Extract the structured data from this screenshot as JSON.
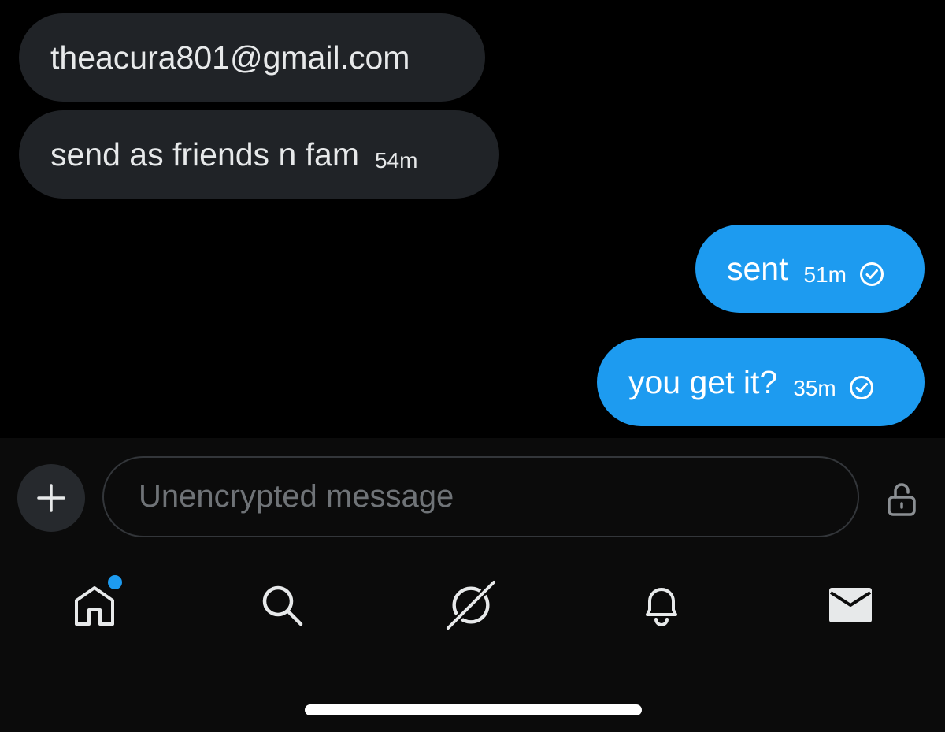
{
  "conversation": {
    "messages": [
      {
        "direction": "incoming",
        "text": "theacura801@gmail.com",
        "time": ""
      },
      {
        "direction": "incoming",
        "text": "send as friends n fam",
        "time": "54m"
      },
      {
        "direction": "outgoing",
        "text": "sent",
        "time": "51m",
        "status_icon": "check-circle-icon"
      },
      {
        "direction": "outgoing",
        "text": "you get it?",
        "time": "35m",
        "status_icon": "check-circle-icon"
      }
    ]
  },
  "composer": {
    "value": "",
    "placeholder": "Unencrypted message",
    "add_icon": "plus-icon",
    "lock_icon": "unlocked-padlock-icon"
  },
  "tab_bar": {
    "items": [
      {
        "name": "home",
        "icon": "home-icon",
        "has_notification_dot": true
      },
      {
        "name": "search",
        "icon": "search-icon"
      },
      {
        "name": "grok",
        "icon": "grok-icon"
      },
      {
        "name": "notifications",
        "icon": "bell-icon"
      },
      {
        "name": "messages",
        "icon": "envelope-icon",
        "active": true
      }
    ]
  },
  "colors": {
    "background": "#000000",
    "incoming_bubble": "#202327",
    "outgoing_bubble": "#1d9bf0",
    "notification_dot": "#1d9bf0",
    "bottom_bar": "#0b0b0b"
  }
}
